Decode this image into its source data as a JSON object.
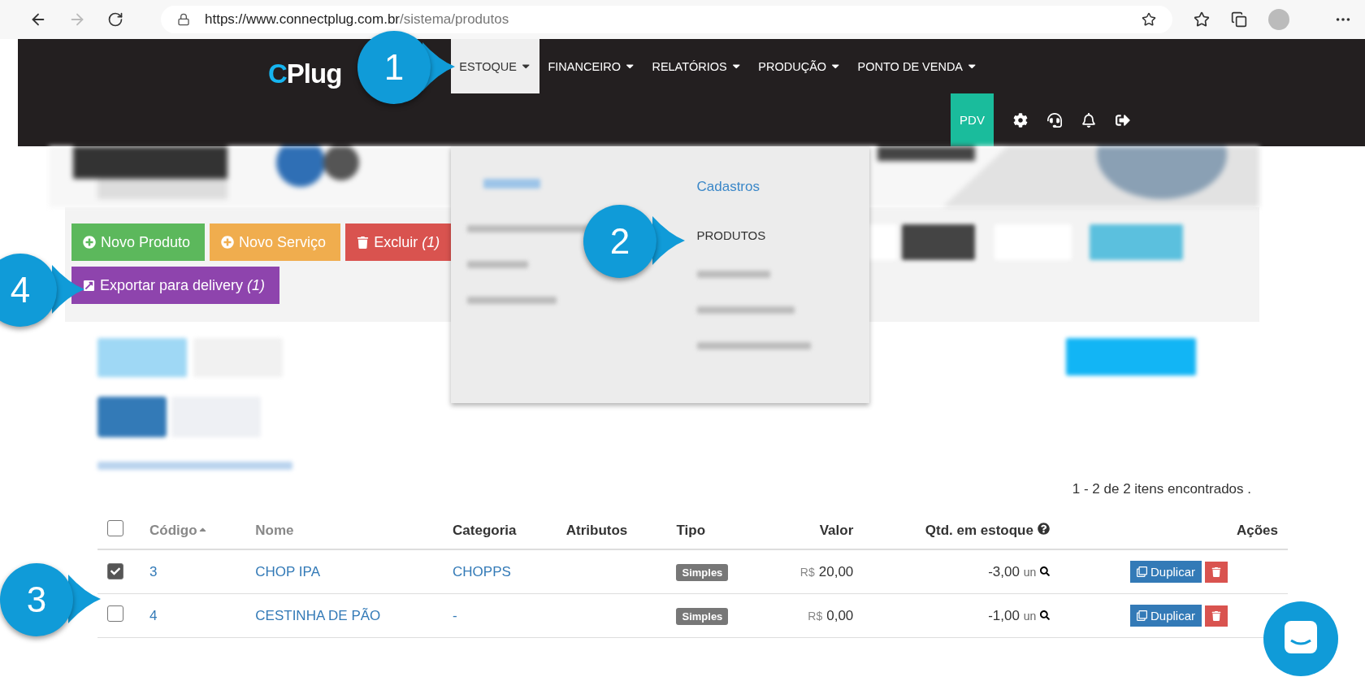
{
  "browser": {
    "url_host": "https://www.connectplug.com.br",
    "url_path": "/sistema/produtos"
  },
  "nav": {
    "logo": "CPlug",
    "menu": [
      {
        "label": "ESTOQUE",
        "selected": true
      },
      {
        "label": "FINANCEIRO",
        "selected": false
      },
      {
        "label": "RELATÓRIOS",
        "selected": false
      },
      {
        "label": "PRODUÇÃO",
        "selected": false
      },
      {
        "label": "PONTO DE VENDA",
        "selected": false
      }
    ],
    "pdv": "PDV"
  },
  "dropdown": {
    "heading": "Cadastros",
    "items": [
      "PRODUTOS"
    ]
  },
  "toolbar": [
    {
      "label": "Novo Produto",
      "kind": "success"
    },
    {
      "label": "Novo Serviço",
      "kind": "warning"
    },
    {
      "label": "Excluir *(1)*",
      "kind": "danger"
    }
  ],
  "export_button": {
    "label": "Exportar para delivery *(1)*"
  },
  "result_count": "1 - 2 de 2 itens encontrados .",
  "table": {
    "select_all": {
      "checked": false
    },
    "columns": [
      {
        "label": "Código",
        "sorted": true
      },
      {
        "label": "Nome",
        "sorted": false
      },
      {
        "label": "Categoria",
        "sorted": false
      },
      {
        "label": "Atributos",
        "sorted": false
      },
      {
        "label": "Tipo",
        "sorted": false
      },
      {
        "label": "Valor",
        "sorted": false
      },
      {
        "label": "Qtd. em estoque",
        "sorted": false,
        "help": true
      },
      {
        "label": "Ações",
        "sorted": false
      }
    ],
    "rows": [
      {
        "checked": true,
        "code": "3",
        "name": "CHOP IPA",
        "category": "CHOPPS",
        "type": "Simples",
        "currency": "R$",
        "value": "20,00",
        "qty": "-3,00",
        "unit": "un",
        "action": "Duplicar"
      },
      {
        "checked": false,
        "code": "4",
        "name": "CESTINHA DE PÃO",
        "category": "-",
        "type": "Simples",
        "currency": "R$",
        "value": "0,00",
        "qty": "-1,00",
        "unit": "un",
        "action": "Duplicar"
      }
    ]
  },
  "callouts": [
    {
      "number": "1"
    },
    {
      "number": "2"
    },
    {
      "number": "3"
    },
    {
      "number": "4"
    }
  ]
}
